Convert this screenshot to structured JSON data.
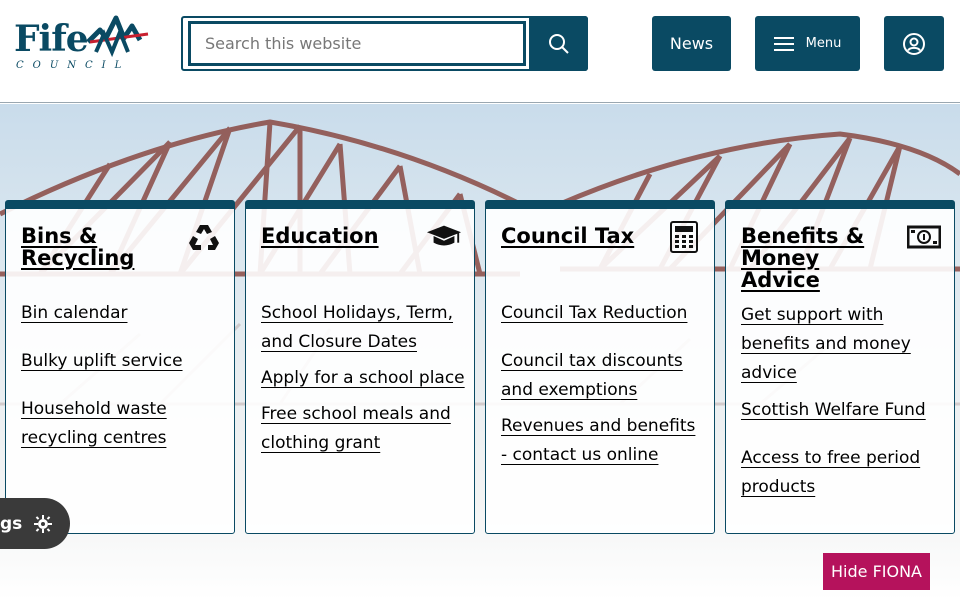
{
  "brand": {
    "name": "Fife",
    "subtitle": "COUNCIL",
    "icon": "fife-council-logo",
    "colors": {
      "primary": "#0a4a63",
      "accent": "#c8202f",
      "fiona": "#b5125c"
    }
  },
  "header": {
    "search": {
      "placeholder": "Search this website",
      "value": "",
      "button_icon": "search-icon"
    },
    "news_label": "News",
    "menu_label": "Menu",
    "menu_icon": "hamburger-icon",
    "account_icon": "user-circle-icon"
  },
  "cards": [
    {
      "title": "Bins & Recycling",
      "icon": "recycle-icon",
      "links": [
        "Bin calendar",
        "Bulky uplift service",
        "Household waste recycling centres"
      ]
    },
    {
      "title": "Education",
      "icon": "graduation-cap-icon",
      "links": [
        "School Holidays, Term, and Closure Dates",
        "Apply for a school place",
        "Free school meals and clothing grant"
      ]
    },
    {
      "title": "Council Tax",
      "icon": "calculator-icon",
      "links": [
        "Council Tax Reduction",
        "Council tax discounts and exemptions",
        "Revenues and benefits - contact us online"
      ]
    },
    {
      "title": "Benefits & Money Advice",
      "icon": "money-note-icon",
      "links": [
        "Get support with benefits and money advice",
        "Scottish Welfare Fund",
        "Access to free period products"
      ]
    }
  ],
  "settings": {
    "label": "gs",
    "icon": "gear-icon"
  },
  "fiona": {
    "label": "Hide FIONA"
  }
}
